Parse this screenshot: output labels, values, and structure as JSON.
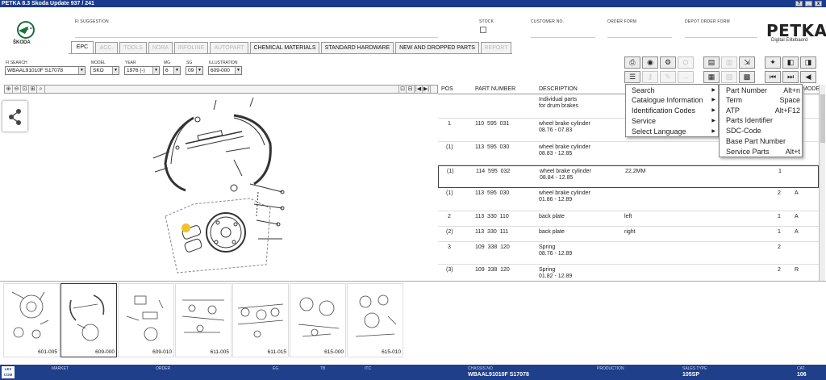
{
  "window": {
    "title": "PETKA 8.3   Skoda Update 937 / 241",
    "controls": [
      "?",
      "_",
      "x"
    ]
  },
  "top_fields": {
    "fi_suggestion": "FI SUGGESTION",
    "stock": "STOCK",
    "customer_no": "CUSTOMER NO.",
    "order_form": "ORDER FORM",
    "depot_order_form": "DEPOT ORDER FORM"
  },
  "brand": {
    "logo_text": "ŠKODA",
    "app_name": "PETKA",
    "app_sub": "Digital Elitebaord",
    "accent": "#1f3f8a"
  },
  "tabs": [
    {
      "label": "EPC",
      "state": "active"
    },
    {
      "label": "ACC.",
      "state": "disabled"
    },
    {
      "label": "TOOLS",
      "state": "disabled"
    },
    {
      "label": "NORA",
      "state": "disabled"
    },
    {
      "label": "INFOLINE",
      "state": "disabled"
    },
    {
      "label": "AUTOPART",
      "state": "disabled"
    },
    {
      "label": "CHEMICAL MATERIALS",
      "state": "normal"
    },
    {
      "label": "STANDARD HARDWARE",
      "state": "normal"
    },
    {
      "label": "NEW AND DROPPED PARTS",
      "state": "normal"
    },
    {
      "label": "REPORT",
      "state": "disabled"
    }
  ],
  "filters": {
    "fi_search": {
      "label": "FI SEARCH",
      "value": "WBAAL91010F S17078"
    },
    "model": {
      "label": "MODEL",
      "value": "SKO"
    },
    "year": {
      "label": "YEAR",
      "value": "1976 (-)"
    },
    "mg": {
      "label": "MG",
      "value": "6"
    },
    "sg": {
      "label": "SG",
      "value": "09"
    },
    "illustration": {
      "label": "ILLUSTRATION",
      "value": "609-000"
    }
  },
  "zoom_buttons": [
    "⊕",
    "⊖",
    "⊡",
    "⊞",
    "⌕"
  ],
  "nav_buttons": [
    "⊡",
    "⊟",
    "|◀",
    "▶|"
  ],
  "parts_table": {
    "columns": [
      "POS",
      "PART NUMBER",
      "DESCRIPTION",
      "",
      "",
      "",
      "MODEL"
    ],
    "rows": [
      {
        "pos": "",
        "part": "",
        "desc": "Individual parts\nfor drum brakes",
        "remark": "",
        "qty": "",
        "model": ""
      },
      {
        "pos": "1",
        "part": "110  595  031",
        "desc": "wheel brake cylinder\n08.76 - 07.83",
        "remark": "",
        "qty": "",
        "model": ""
      },
      {
        "pos": "(1)",
        "part": "113  595  030",
        "desc": "wheel brake cylinder\n08.83 - 12.85",
        "remark": "",
        "qty": "",
        "model": ""
      },
      {
        "pos": "(1)",
        "part": "114  595  032",
        "desc": "wheel brake cylinder\n08.84 - 12.85",
        "remark": "22,2MM",
        "qty": "1",
        "model": ""
      },
      {
        "pos": "(1)",
        "part": "113  595  030",
        "desc": "wheel brake cylinder\n01.86 - 12.89",
        "remark": "",
        "qty": "2",
        "model": "A"
      },
      {
        "pos": "2",
        "part": "113  330  110",
        "desc": "back plate",
        "remark": "left",
        "qty": "1",
        "model": "A"
      },
      {
        "pos": "(2)",
        "part": "113  330  111",
        "desc": "back plate",
        "remark": "right",
        "qty": "1",
        "model": "A"
      },
      {
        "pos": "3",
        "part": "109  338  120",
        "desc": "Spring\n08.76 - 12.89",
        "remark": "",
        "qty": "2",
        "model": ""
      },
      {
        "pos": "(3)",
        "part": "109  338  120",
        "desc": "Spring\n01.82 - 12.89",
        "remark": "",
        "qty": "2",
        "model": "R"
      }
    ]
  },
  "context_menu": {
    "items": [
      "Search",
      "Catalogue Information",
      "Identification Codes",
      "Service",
      "Select Language"
    ],
    "submenu": [
      {
        "label": "Part Number",
        "key": "Alt+n"
      },
      {
        "label": "Term",
        "key": "Space"
      },
      {
        "label": "ATP",
        "key": "Alt+F12"
      },
      {
        "label": "Parts Identifier",
        "key": ""
      },
      {
        "label": "SDC-Code",
        "key": ""
      },
      {
        "label": "Base Part Number",
        "key": ""
      },
      {
        "label": "Service Parts",
        "key": "Alt+t"
      }
    ]
  },
  "thumbnails": [
    {
      "label": "601-005",
      "selected": false
    },
    {
      "label": "609-000",
      "selected": true
    },
    {
      "label": "609-010",
      "selected": false
    },
    {
      "label": "611-005",
      "selected": false
    },
    {
      "label": "611-015",
      "selected": false
    },
    {
      "label": "615-000",
      "selected": false
    },
    {
      "label": "615-010",
      "selected": false
    }
  ],
  "status": {
    "logo": "LEX COM",
    "market": {
      "label": "MARKET",
      "value": ""
    },
    "order": {
      "label": "ORDER",
      "value": ""
    },
    "eg": {
      "label": "EG",
      "value": ""
    },
    "tb": {
      "label": "TB",
      "value": ""
    },
    "itc": {
      "label": "ITC",
      "value": ""
    },
    "chassis_no": {
      "label": "CHASSIS NO",
      "value": "WBAAL91010F S17078"
    },
    "production": {
      "label": "PRODUCTION",
      "value": ""
    },
    "sales_type": {
      "label": "SALES TYPE",
      "value": "105SP"
    },
    "cat": {
      "label": "CAT.",
      "value": "106"
    }
  }
}
